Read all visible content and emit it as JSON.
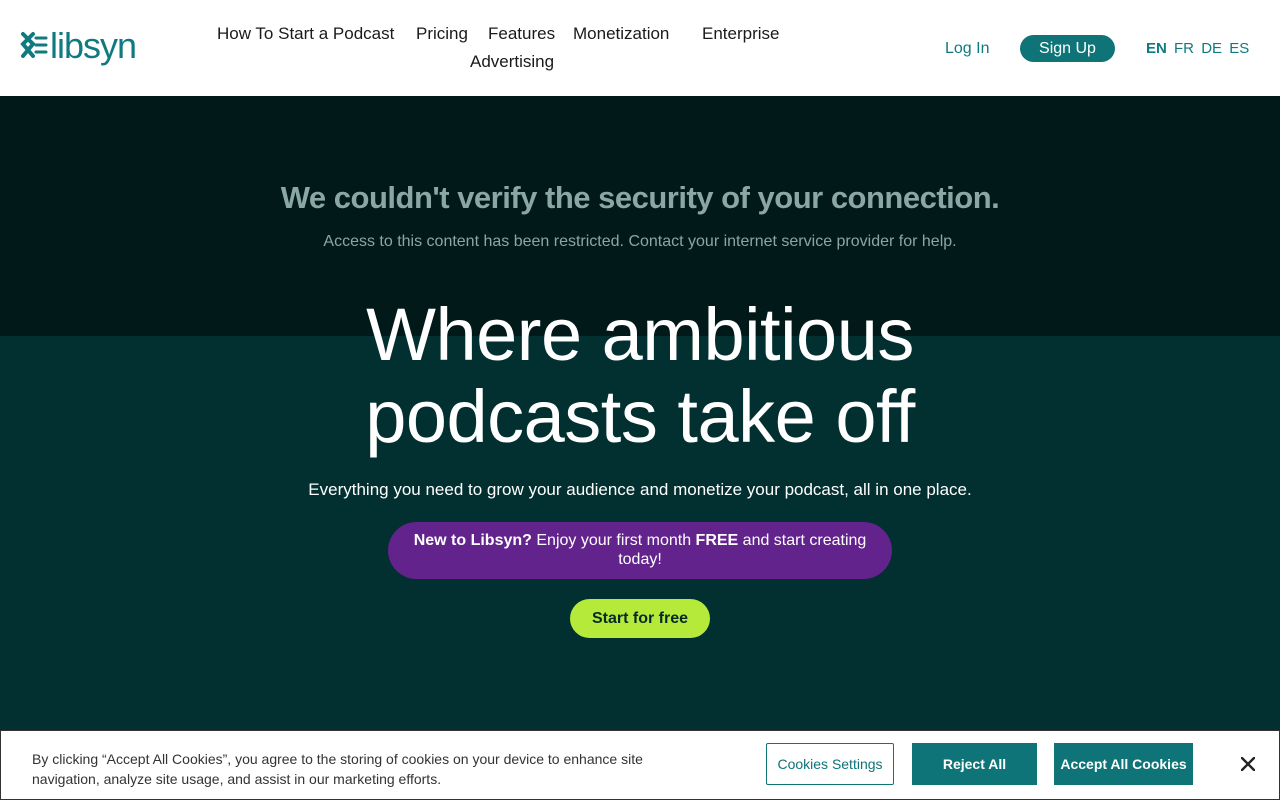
{
  "brand": {
    "name": "libsyn",
    "color": "#0f7a7f"
  },
  "nav": {
    "items": [
      "How To Start a Podcast",
      "Pricing",
      "Features",
      "Monetization",
      "Enterprise",
      "Advertising"
    ]
  },
  "header": {
    "login_label": "Log In",
    "signup_label": "Sign Up",
    "languages": [
      "EN",
      "FR",
      "DE",
      "ES"
    ],
    "active_language": "EN"
  },
  "warning": {
    "title": "We couldn't verify the security of your connection.",
    "subtitle": "Access to this content has been restricted. Contact your internet service provider for help."
  },
  "hero": {
    "title_line1": "Where ambitious",
    "title_line2": "podcasts take off",
    "subtitle": "Everything you need to grow your audience and monetize your podcast, all in one place.",
    "promo_bold1": "New to Libsyn?",
    "promo_text1": " Enjoy your first month ",
    "promo_bold2": "FREE",
    "promo_text2": " and start creating today!",
    "cta_label": "Start for free"
  },
  "cookie": {
    "text": "By clicking “Accept All Cookies”, you agree to the storing of cookies on your device to enhance site navigation, analyze site usage, and assist in our marketing efforts.",
    "settings_label": "Cookies Settings",
    "reject_label": "Reject All",
    "accept_label": "Accept All Cookies"
  },
  "colors": {
    "teal": "#0e7478",
    "hero_dark": "#02191a",
    "hero_teal": "#022f30",
    "promo_purple": "#62238c",
    "cta_green": "#b5ea3b"
  }
}
